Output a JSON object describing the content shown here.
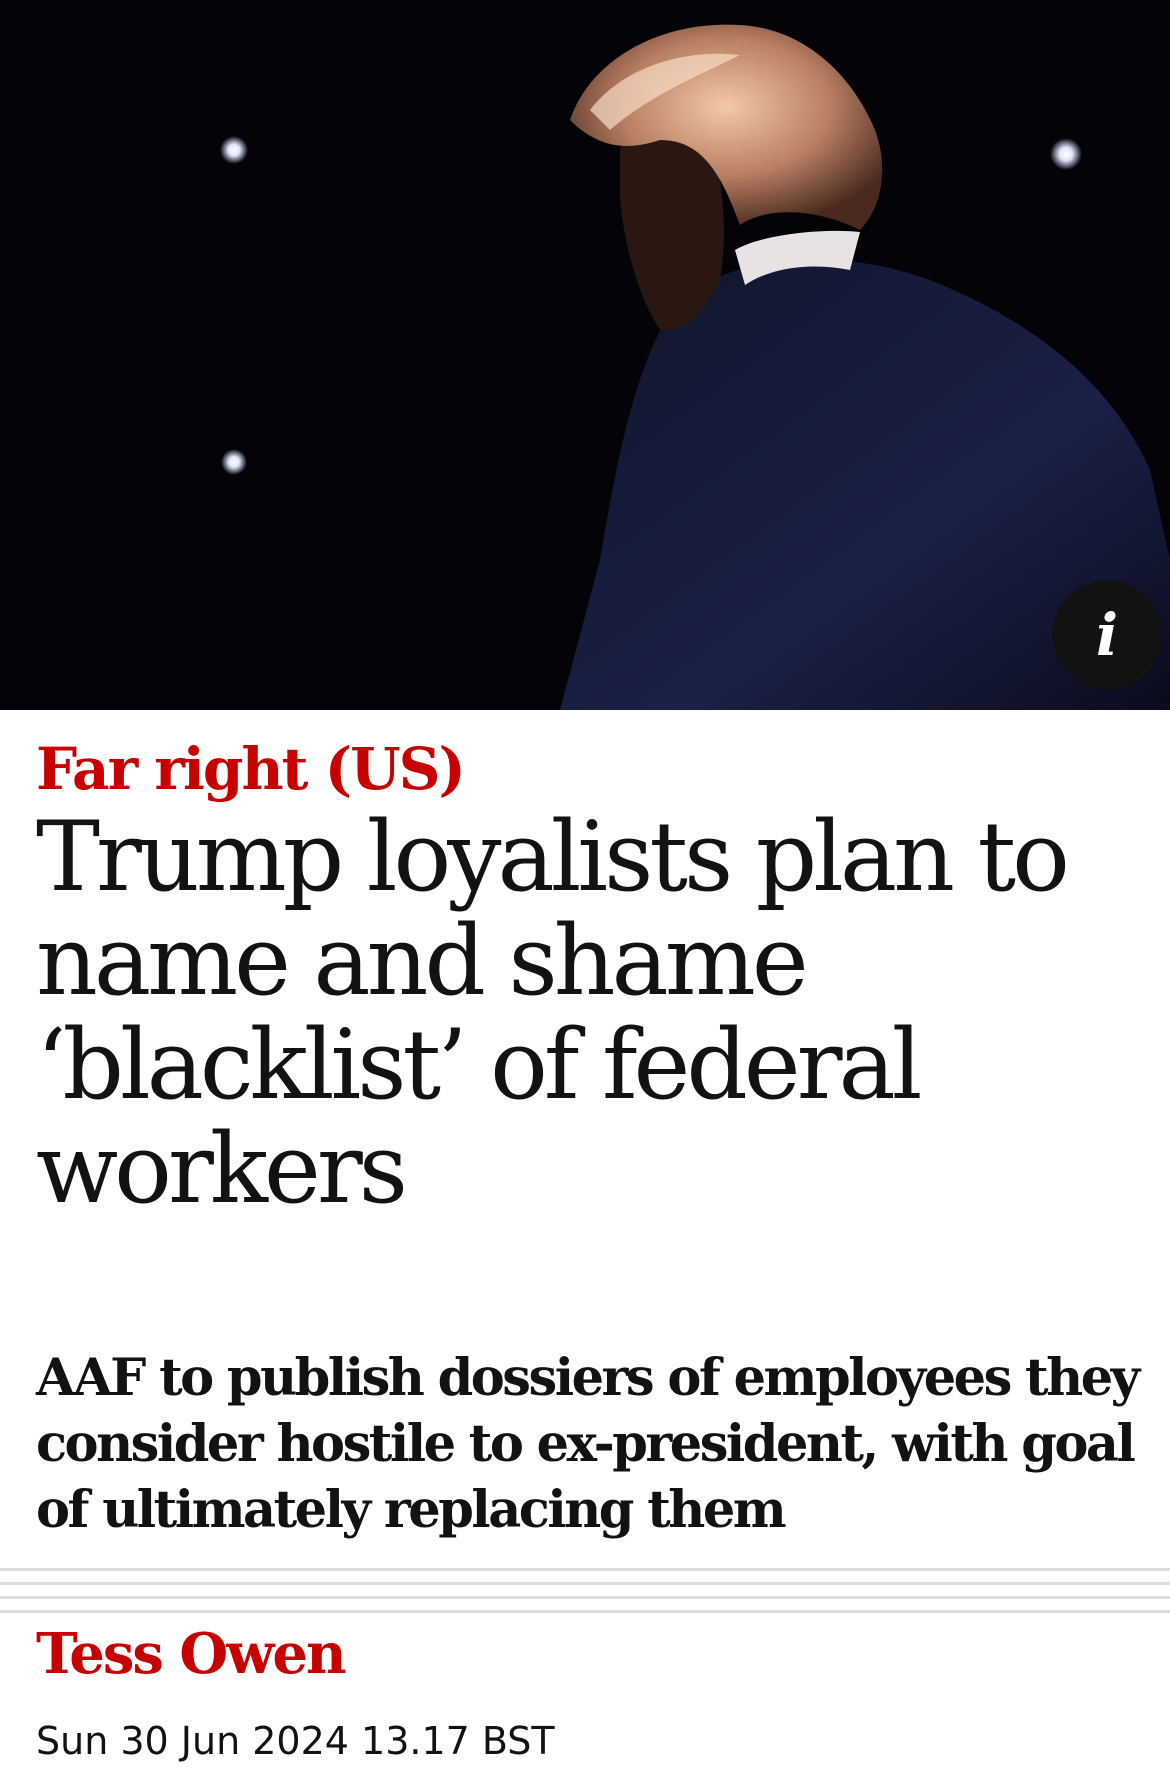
{
  "article": {
    "kicker": "Far right (US)",
    "headline": "Trump loyalists plan to name and shame ‘blacklist’ of federal workers",
    "standfirst": "AAF to publish dossiers of employees they consider hostile to ex-president, with goal of ultimately replacing them",
    "byline": "Tess Owen",
    "dateline": "Sun 30 Jun 2024 13.17 BST"
  },
  "hero": {
    "info_icon_glyph": "i",
    "info_icon": "info-icon"
  },
  "colors": {
    "accent": "#c70000",
    "text": "#121212",
    "hero_background": "#030308",
    "divider": "#dcdcdc"
  }
}
